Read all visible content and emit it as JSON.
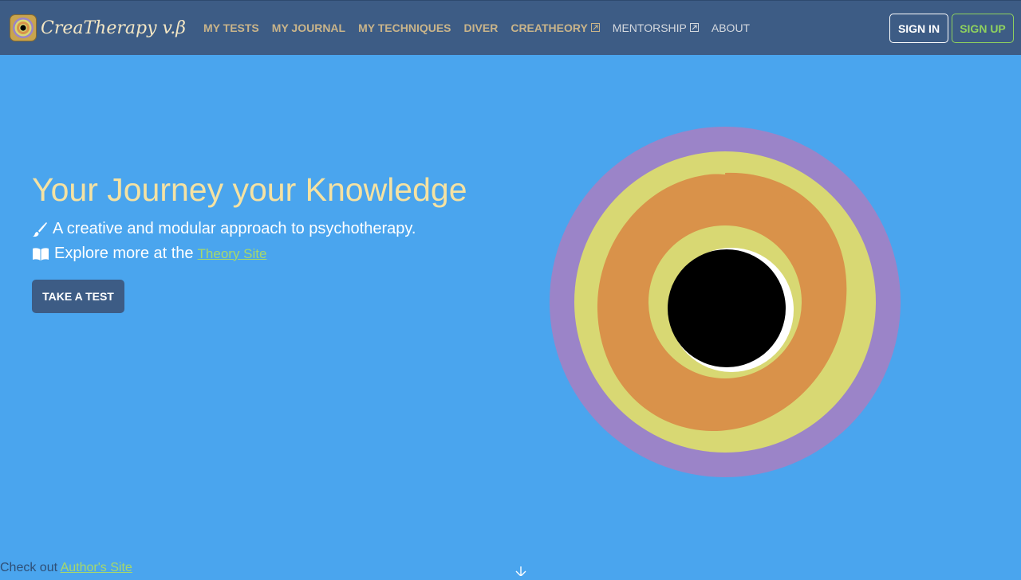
{
  "brand": {
    "name": "CreaTherapy v.β"
  },
  "nav": {
    "items": [
      {
        "label": "MY TESTS"
      },
      {
        "label": "MY JOURNAL"
      },
      {
        "label": "MY TECHNIQUES"
      },
      {
        "label": "DIVER"
      },
      {
        "label": "CREATHEORY"
      },
      {
        "label": "MENTORSHIP"
      },
      {
        "label": "ABOUT"
      }
    ],
    "sign_in": "SIGN IN",
    "sign_up": "SIGN UP"
  },
  "hero": {
    "title": "Your Journey your Knowledge",
    "line1": "A creative and modular approach to psychotherapy.",
    "line2_prefix": "Explore more at the",
    "line2_link": "Theory Site",
    "cta": "TAKE A TEST"
  },
  "footer": {
    "prefix": "Check out",
    "link": "Author's Site"
  },
  "icons": {
    "brush": "paintbrush-icon",
    "book": "book-icon",
    "external": "external-link-icon"
  },
  "colors": {
    "background": "#4aa5ee",
    "navbar": "#3d5c85",
    "title": "#f5e2a2",
    "accent_green": "#8fd15e",
    "ring_purple": "#9b84c8",
    "ring_yellow": "#d8d873",
    "ring_orange": "#d9924a"
  }
}
